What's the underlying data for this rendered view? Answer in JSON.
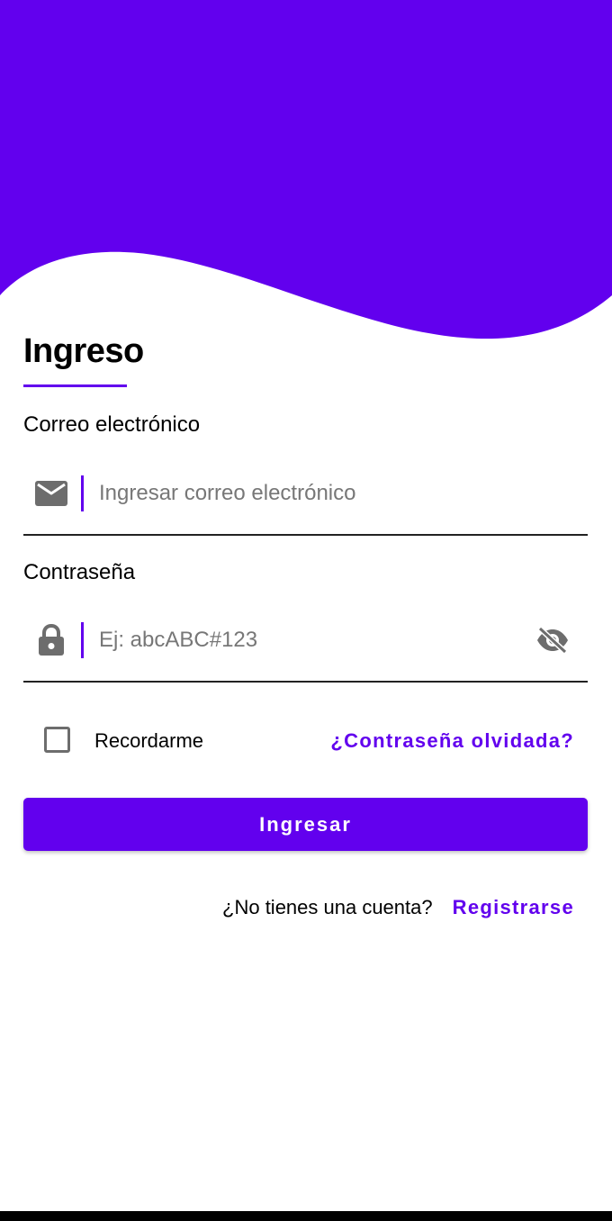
{
  "colors": {
    "accent": "#6200ee",
    "header_bg": "#6200ee",
    "text": "#000000",
    "placeholder": "#777777",
    "icon": "#6d6d6d"
  },
  "login": {
    "title": "Ingreso",
    "email": {
      "label": "Correo electrónico",
      "placeholder": "Ingresar correo electrónico",
      "value": "",
      "icon": "email-icon"
    },
    "password": {
      "label": "Contraseña",
      "placeholder": "Ej: abcABC#123",
      "value": "",
      "icon": "lock-icon",
      "visibility_icon": "eye-off-icon"
    },
    "remember_label": "Recordarme",
    "remember_checked": false,
    "forgot_link": "¿Contraseña olvidada?",
    "submit_label": "Ingresar",
    "register_question": "¿No tienes una cuenta?",
    "register_link": "Registrarse"
  }
}
